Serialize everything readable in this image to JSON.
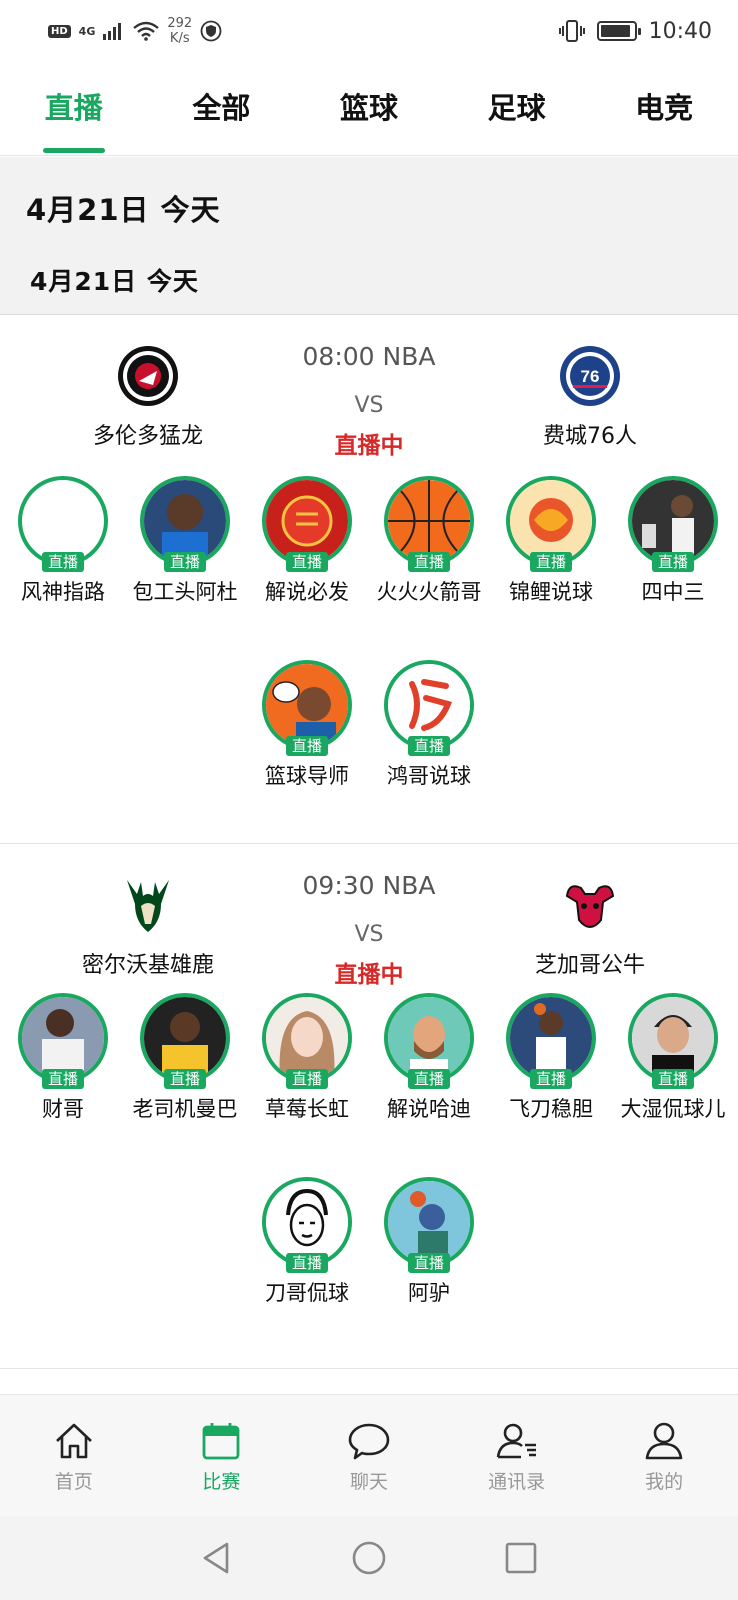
{
  "status_bar": {
    "hd": "HD",
    "network": "4G",
    "speed_value": "292",
    "speed_unit": "K/s",
    "time": "10:40",
    "battery_level": 0.9
  },
  "tabs": [
    {
      "label": "直播",
      "active": true
    },
    {
      "label": "全部",
      "active": false
    },
    {
      "label": "篮球",
      "active": false
    },
    {
      "label": "足球",
      "active": false
    },
    {
      "label": "电竞",
      "active": false
    }
  ],
  "date_header": {
    "main": "4月21日 今天",
    "sub": "4月21日  今天"
  },
  "matches": [
    {
      "time_league": "08:00 NBA",
      "vs": "VS",
      "status": "直播中",
      "home": {
        "name": "多伦多猛龙",
        "logo_icon": "raptors-logo-icon"
      },
      "away": {
        "name": "费城76人",
        "logo_icon": "76ers-logo-icon"
      },
      "streamers": [
        {
          "name": "风神指路",
          "tag": "直播"
        },
        {
          "name": "包工头阿杜",
          "tag": "直播"
        },
        {
          "name": "解说必发",
          "tag": "直播"
        },
        {
          "name": "火火火箭哥",
          "tag": "直播"
        },
        {
          "name": "锦鲤说球",
          "tag": "直播"
        },
        {
          "name": "四中三",
          "tag": "直播"
        },
        {
          "name": "篮球导师",
          "tag": "直播"
        },
        {
          "name": "鸿哥说球",
          "tag": "直播"
        }
      ]
    },
    {
      "time_league": "09:30 NBA",
      "vs": "VS",
      "status": "直播中",
      "home": {
        "name": "密尔沃基雄鹿",
        "logo_icon": "bucks-logo-icon"
      },
      "away": {
        "name": "芝加哥公牛",
        "logo_icon": "bulls-logo-icon"
      },
      "streamers": [
        {
          "name": "财哥",
          "tag": "直播"
        },
        {
          "name": "老司机曼巴",
          "tag": "直播"
        },
        {
          "name": "草莓长虹",
          "tag": "直播"
        },
        {
          "name": "解说哈迪",
          "tag": "直播"
        },
        {
          "name": "飞刀稳胆",
          "tag": "直播"
        },
        {
          "name": "大湿侃球儿",
          "tag": "直播"
        },
        {
          "name": "刀哥侃球",
          "tag": "直播"
        },
        {
          "name": "阿驴",
          "tag": "直播"
        }
      ]
    }
  ],
  "bottom_nav": [
    {
      "label": "首页",
      "icon": "home-icon",
      "active": false
    },
    {
      "label": "比赛",
      "icon": "calendar-icon",
      "active": true
    },
    {
      "label": "聊天",
      "icon": "chat-icon",
      "active": false
    },
    {
      "label": "通讯录",
      "icon": "contacts-icon",
      "active": false
    },
    {
      "label": "我的",
      "icon": "profile-icon",
      "active": false
    }
  ],
  "colors": {
    "accent": "#1aa760",
    "live_red": "#d62a2a"
  }
}
